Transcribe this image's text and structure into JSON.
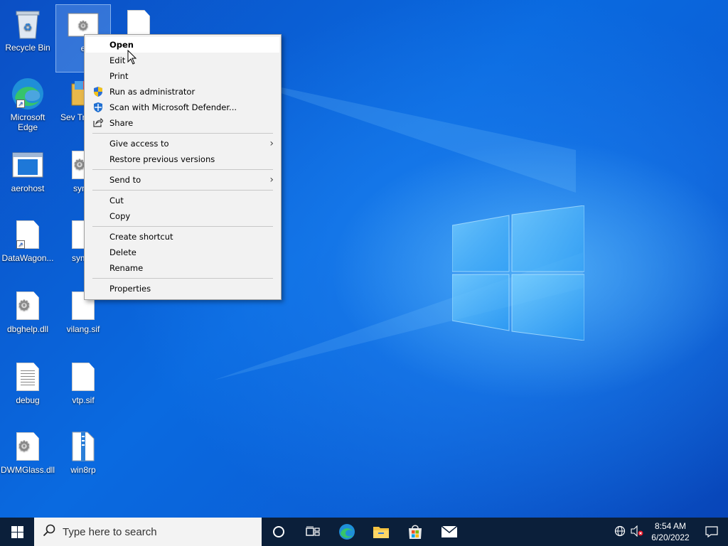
{
  "desktop": {
    "icons": [
      {
        "label": "Recycle Bin"
      },
      {
        "label": "e"
      },
      {
        "label": ""
      },
      {
        "label": "Microsoft Edge"
      },
      {
        "label": "Sev Transfo"
      },
      {
        "label": "aerohost"
      },
      {
        "label": "syms"
      },
      {
        "label": "DataWagon..."
      },
      {
        "label": "symsr"
      },
      {
        "label": "dbghelp.dll"
      },
      {
        "label": "vilang.sif"
      },
      {
        "label": "debug"
      },
      {
        "label": "vtp.sif"
      },
      {
        "label": "DWMGlass.dll"
      },
      {
        "label": "win8rp"
      }
    ]
  },
  "context_menu": {
    "items": [
      {
        "label": "Open"
      },
      {
        "label": "Edit"
      },
      {
        "label": "Print"
      },
      {
        "label": "Run as administrator",
        "icon": "shield-icon"
      },
      {
        "label": "Scan with Microsoft Defender...",
        "icon": "defender-icon"
      },
      {
        "label": "Share",
        "icon": "share-icon"
      },
      {
        "label": "Give access to",
        "submenu": true
      },
      {
        "label": "Restore previous versions"
      },
      {
        "label": "Send to",
        "submenu": true
      },
      {
        "label": "Cut"
      },
      {
        "label": "Copy"
      },
      {
        "label": "Create shortcut"
      },
      {
        "label": "Delete"
      },
      {
        "label": "Rename"
      },
      {
        "label": "Properties"
      }
    ]
  },
  "taskbar": {
    "search_placeholder": "Type here to search",
    "time": "8:54 AM",
    "date": "6/20/2022"
  },
  "colors": {
    "taskbar": "#0b1f3a",
    "menu_bg": "#f2f2f2",
    "desktop_blue": "#0a64d6"
  }
}
